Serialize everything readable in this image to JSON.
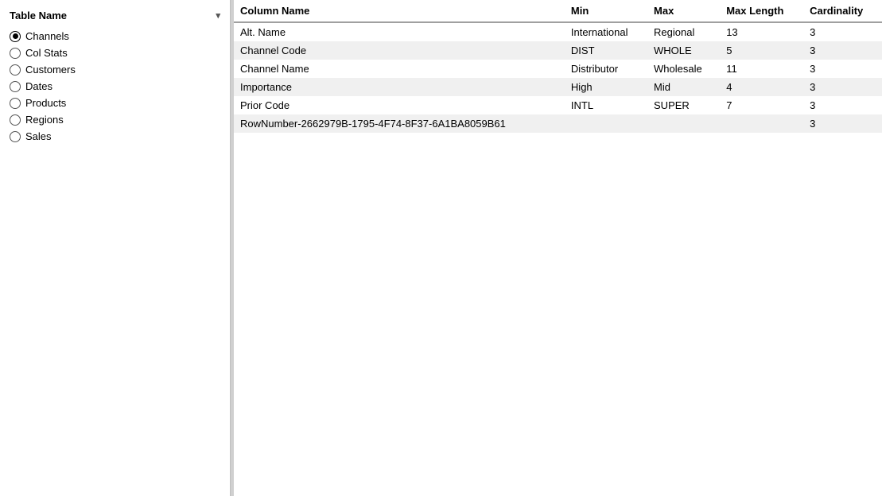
{
  "sidebar": {
    "header": "Table Name",
    "chevron": "▾",
    "items": [
      {
        "label": "Channels",
        "selected": true
      },
      {
        "label": "Col Stats",
        "selected": false
      },
      {
        "label": "Customers",
        "selected": false
      },
      {
        "label": "Dates",
        "selected": false
      },
      {
        "label": "Products",
        "selected": false
      },
      {
        "label": "Regions",
        "selected": false
      },
      {
        "label": "Sales",
        "selected": false
      }
    ]
  },
  "table": {
    "columns": [
      {
        "key": "column_name",
        "label": "Column Name"
      },
      {
        "key": "min",
        "label": "Min"
      },
      {
        "key": "max",
        "label": "Max"
      },
      {
        "key": "max_length",
        "label": "Max Length"
      },
      {
        "key": "cardinality",
        "label": "Cardinality"
      }
    ],
    "rows": [
      {
        "column_name": "Alt. Name",
        "min": "International",
        "max": "Regional",
        "max_length": "13",
        "cardinality": "3"
      },
      {
        "column_name": "Channel Code",
        "min": "DIST",
        "max": "WHOLE",
        "max_length": "5",
        "cardinality": "3"
      },
      {
        "column_name": "Channel Name",
        "min": "Distributor",
        "max": "Wholesale",
        "max_length": "11",
        "cardinality": "3"
      },
      {
        "column_name": "Importance",
        "min": "High",
        "max": "Mid",
        "max_length": "4",
        "cardinality": "3"
      },
      {
        "column_name": "Prior Code",
        "min": "INTL",
        "max": "SUPER",
        "max_length": "7",
        "cardinality": "3"
      },
      {
        "column_name": "RowNumber-2662979B-1795-4F74-8F37-6A1BA8059B61",
        "min": "",
        "max": "",
        "max_length": "",
        "cardinality": "3"
      }
    ]
  }
}
